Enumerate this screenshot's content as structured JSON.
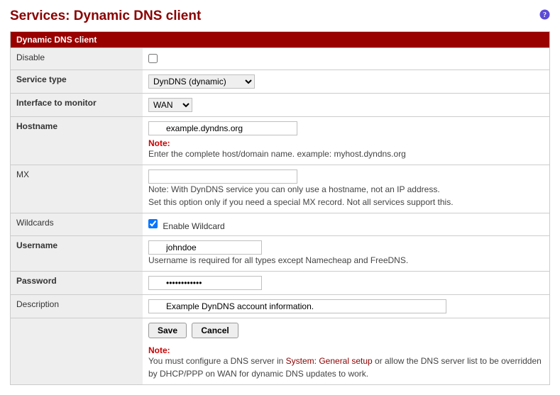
{
  "page": {
    "title": "Services: Dynamic DNS client"
  },
  "section": {
    "header": "Dynamic DNS client"
  },
  "rows": {
    "disable": {
      "label": "Disable",
      "checked": false
    },
    "service": {
      "label": "Service type",
      "value": "DynDNS (dynamic)"
    },
    "iface": {
      "label": "Interface to monitor",
      "value": "WAN"
    },
    "hostname": {
      "label": "Hostname",
      "value": "example.dyndns.org",
      "note_label": "Note:",
      "note": "Enter the complete host/domain name. example: myhost.dyndns.org"
    },
    "mx": {
      "label": "MX",
      "value": "",
      "note": "Note: With DynDNS service you can only use a hostname, not an IP address.\nSet this option only if you need a special MX record. Not all services support this."
    },
    "wildcards": {
      "label": "Wildcards",
      "checkbox_label": "Enable Wildcard",
      "checked": true
    },
    "username": {
      "label": "Username",
      "value": "johndoe",
      "note": "Username is required for all types except Namecheap and FreeDNS."
    },
    "password": {
      "label": "Password",
      "value": "••••••••••••"
    },
    "description": {
      "label": "Description",
      "value": "Example DynDNS account information."
    }
  },
  "buttons": {
    "save": "Save",
    "cancel": "Cancel"
  },
  "footer": {
    "note_label": "Note:",
    "text_before": "You must configure a DNS server in ",
    "link": "System: General setup",
    "text_after": " or allow the DNS server list to be overridden by DHCP/PPP on WAN for dynamic DNS updates to work."
  }
}
